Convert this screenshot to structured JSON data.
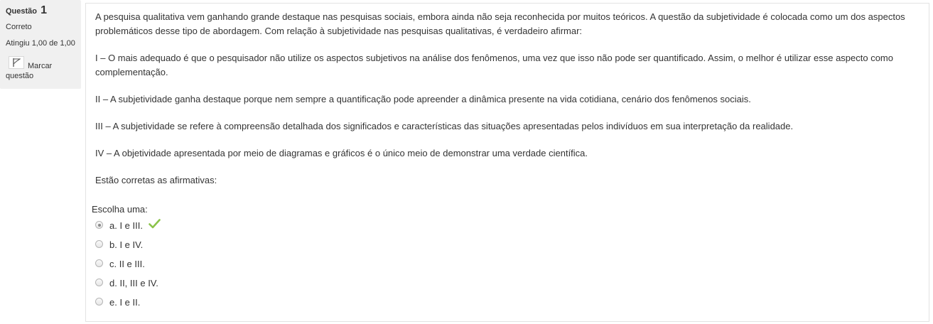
{
  "info": {
    "question_label": "Questão",
    "question_number": "1",
    "state": "Correto",
    "grade": "Atingiu 1,00 de 1,00",
    "flag_label": "Marcar questão"
  },
  "question": {
    "paragraphs": [
      "A pesquisa qualitativa vem ganhando grande destaque nas pesquisas sociais, embora ainda não seja reconhecida por muitos teóricos. A questão da subjetividade é colocada como um dos aspectos problemáticos desse tipo de abordagem. Com relação à subjetividade nas pesquisas qualitativas, é verdadeiro afirmar:",
      "I – O mais adequado é que o pesquisador não utilize os aspectos subjetivos na análise dos fenômenos, uma vez que isso não pode ser quantificado. Assim, o melhor é utilizar esse aspecto como complementação.",
      "II – A subjetividade ganha destaque porque nem sempre a quantificação pode apreender a dinâmica presente na vida cotidiana, cenário dos fenômenos sociais.",
      "III – A subjetividade se refere à compreensão detalhada dos significados e características das situações apresentadas pelos indivíduos em sua interpretação da realidade.",
      "IV – A objetividade apresentada por meio de diagramas e gráficos é o único meio de demonstrar uma verdade científica.",
      "Estão corretas as afirmativas:"
    ],
    "prompt": "Escolha uma:",
    "answers": [
      {
        "label": "a. I e III.",
        "selected": true,
        "correct": true
      },
      {
        "label": "b. I e IV.",
        "selected": false,
        "correct": false
      },
      {
        "label": "c. II e III.",
        "selected": false,
        "correct": false
      },
      {
        "label": "d. II, III e IV.",
        "selected": false,
        "correct": false
      },
      {
        "label": "e. I e II.",
        "selected": false,
        "correct": false
      }
    ]
  },
  "colors": {
    "panel_bg": "#f0f0f0",
    "check_green": "#8bc34a",
    "text": "#333333"
  },
  "icons": {
    "flag": "flag-icon",
    "correct": "checkmark-icon"
  }
}
